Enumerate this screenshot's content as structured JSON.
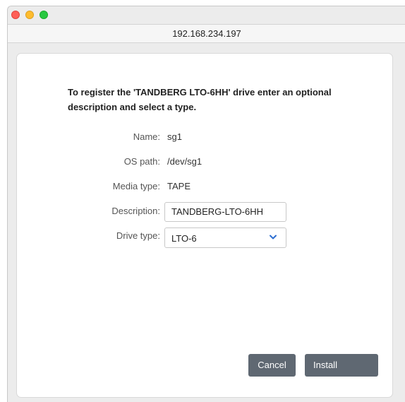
{
  "window": {
    "address": "192.168.234.197"
  },
  "dialog": {
    "intro": "To register the 'TANDBERG LTO-6HH' drive enter an optional description and select a type.",
    "fields": {
      "name": {
        "label": "Name:",
        "value": "sg1"
      },
      "os_path": {
        "label": "OS path:",
        "value": "/dev/sg1"
      },
      "media_type": {
        "label": "Media type:",
        "value": "TAPE"
      },
      "description": {
        "label": "Description:",
        "value": "TANDBERG-LTO-6HH"
      },
      "drive_type": {
        "label": "Drive type:",
        "value": "LTO-6"
      }
    },
    "buttons": {
      "cancel": "Cancel",
      "install": "Install"
    }
  },
  "colors": {
    "button_bg": "#5f6872",
    "chevron": "#2f6fd1",
    "close": "#fe5f57",
    "minimize": "#febc2e",
    "maximize": "#28c840"
  },
  "icons": {
    "close": "close-icon",
    "minimize": "minimize-icon",
    "maximize": "maximize-icon",
    "dropdown": "chevron-down-icon"
  }
}
